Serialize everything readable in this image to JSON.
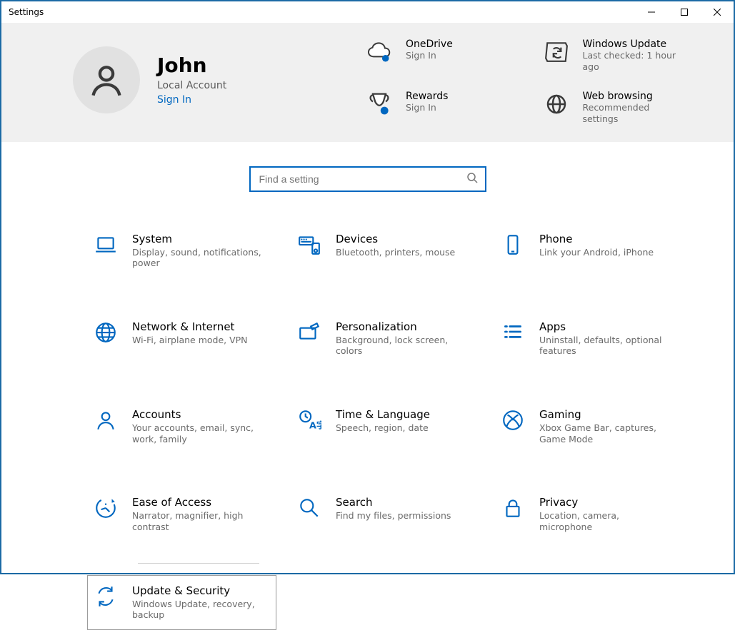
{
  "window": {
    "title": "Settings"
  },
  "profile": {
    "name": "John",
    "account_type": "Local Account",
    "sign_in": "Sign In"
  },
  "tiles": {
    "onedrive": {
      "title": "OneDrive",
      "sub": "Sign In"
    },
    "update": {
      "title": "Windows Update",
      "sub": "Last checked: 1 hour ago"
    },
    "rewards": {
      "title": "Rewards",
      "sub": "Sign In"
    },
    "browsing": {
      "title": "Web browsing",
      "sub": "Recommended settings"
    }
  },
  "search": {
    "placeholder": "Find a setting"
  },
  "categories": [
    {
      "id": "system",
      "title": "System",
      "sub": "Display, sound, notifications, power"
    },
    {
      "id": "devices",
      "title": "Devices",
      "sub": "Bluetooth, printers, mouse"
    },
    {
      "id": "phone",
      "title": "Phone",
      "sub": "Link your Android, iPhone"
    },
    {
      "id": "network",
      "title": "Network & Internet",
      "sub": "Wi-Fi, airplane mode, VPN"
    },
    {
      "id": "personalization",
      "title": "Personalization",
      "sub": "Background, lock screen, colors"
    },
    {
      "id": "apps",
      "title": "Apps",
      "sub": "Uninstall, defaults, optional features"
    },
    {
      "id": "accounts",
      "title": "Accounts",
      "sub": "Your accounts, email, sync, work, family"
    },
    {
      "id": "time",
      "title": "Time & Language",
      "sub": "Speech, region, date"
    },
    {
      "id": "gaming",
      "title": "Gaming",
      "sub": "Xbox Game Bar, captures, Game Mode"
    },
    {
      "id": "ease",
      "title": "Ease of Access",
      "sub": "Narrator, magnifier, high contrast"
    },
    {
      "id": "search",
      "title": "Search",
      "sub": "Find my files, permissions"
    },
    {
      "id": "privacy",
      "title": "Privacy",
      "sub": "Location, camera, microphone"
    },
    {
      "id": "update-security",
      "title": "Update & Security",
      "sub": "Windows Update, recovery, backup"
    }
  ],
  "selected_category": "update-security",
  "colors": {
    "accent": "#0067c0"
  }
}
